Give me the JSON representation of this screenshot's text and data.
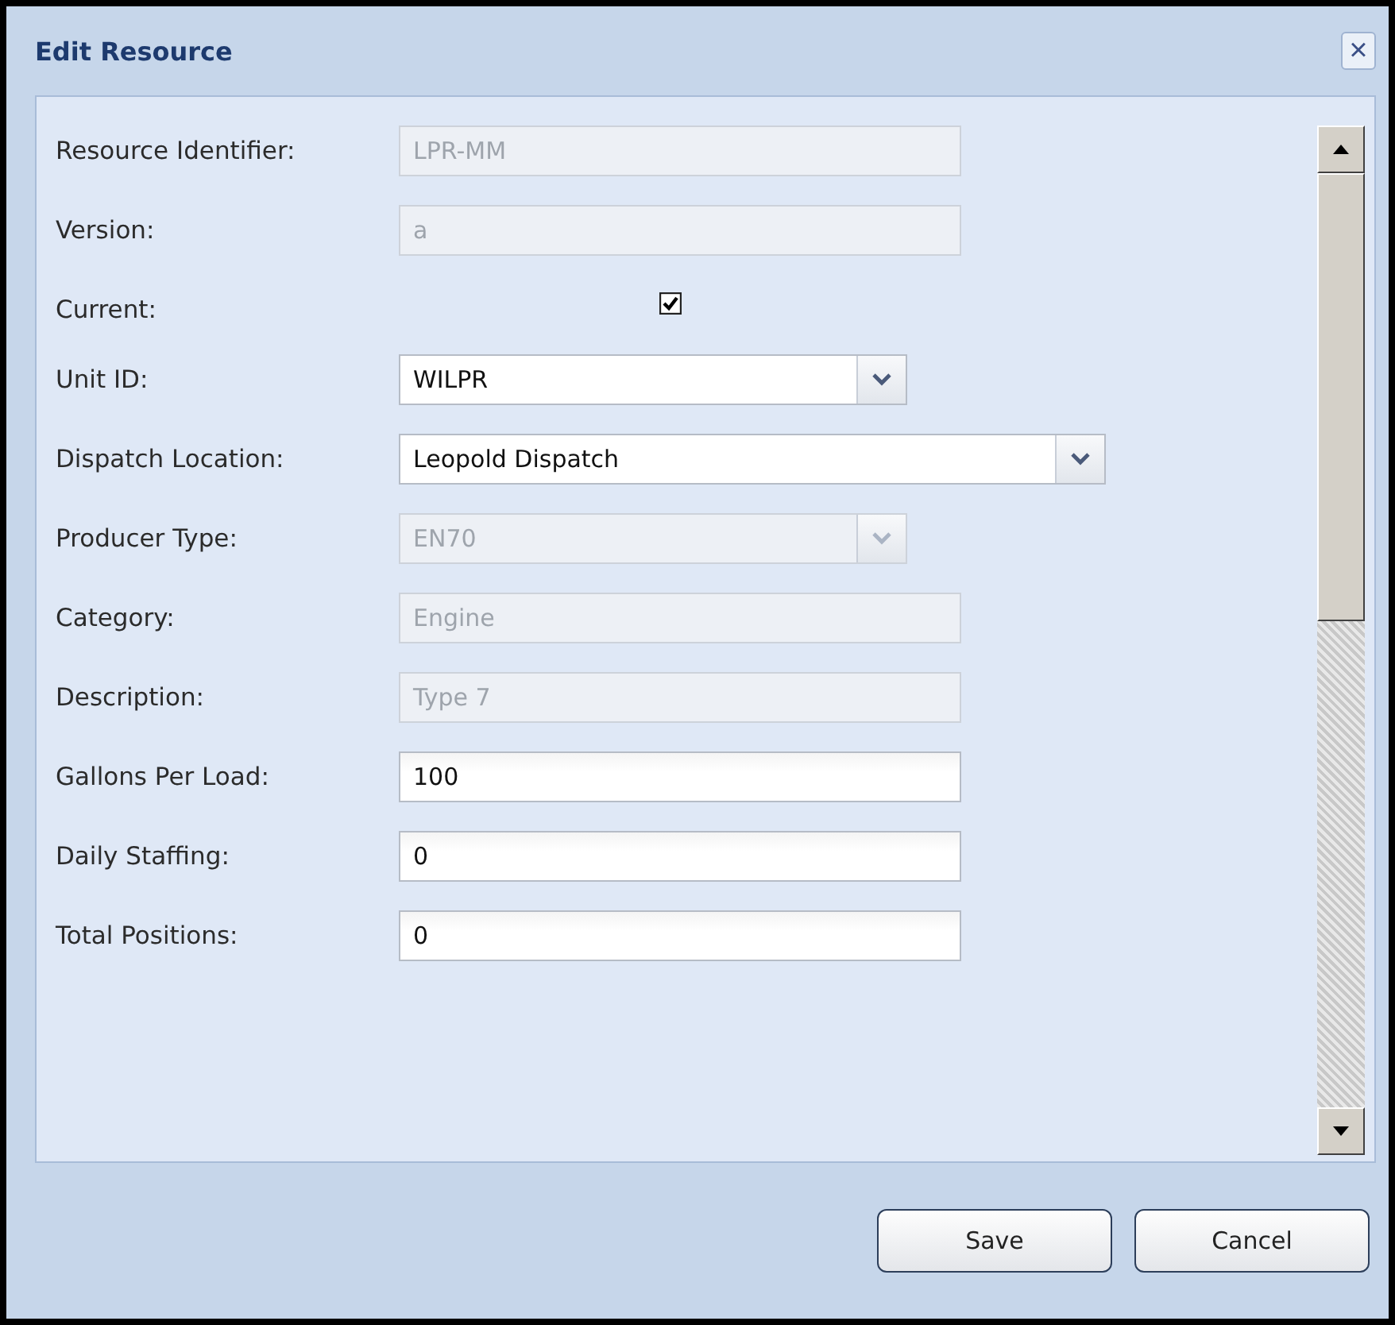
{
  "window": {
    "title": "Edit Resource",
    "close": "×"
  },
  "fields": [
    {
      "kind": "text",
      "label": "Resource Identifier:",
      "value": "LPR-MM",
      "disabled": true
    },
    {
      "kind": "text",
      "label": "Version:",
      "value": "a",
      "disabled": true
    },
    {
      "kind": "checkbox",
      "label": "Current:",
      "checked": true
    },
    {
      "kind": "select",
      "label": "Unit ID:",
      "value": "WILPR",
      "disabled": false,
      "wide": false
    },
    {
      "kind": "select",
      "label": "Dispatch Location:",
      "value": "Leopold Dispatch",
      "disabled": false,
      "wide": true
    },
    {
      "kind": "select",
      "label": "Producer Type:",
      "value": "EN70",
      "disabled": true,
      "wide": false
    },
    {
      "kind": "text",
      "label": "Category:",
      "value": "Engine",
      "disabled": true
    },
    {
      "kind": "text",
      "label": "Description:",
      "value": "Type 7",
      "disabled": true
    },
    {
      "kind": "text",
      "label": "Gallons Per Load:",
      "value": "100",
      "disabled": false
    },
    {
      "kind": "text",
      "label": "Daily Staffing:",
      "value": "0",
      "disabled": false
    },
    {
      "kind": "text",
      "label": "Total Positions:",
      "value": "0",
      "disabled": false
    }
  ],
  "buttons": [
    "Save",
    "Cancel"
  ]
}
